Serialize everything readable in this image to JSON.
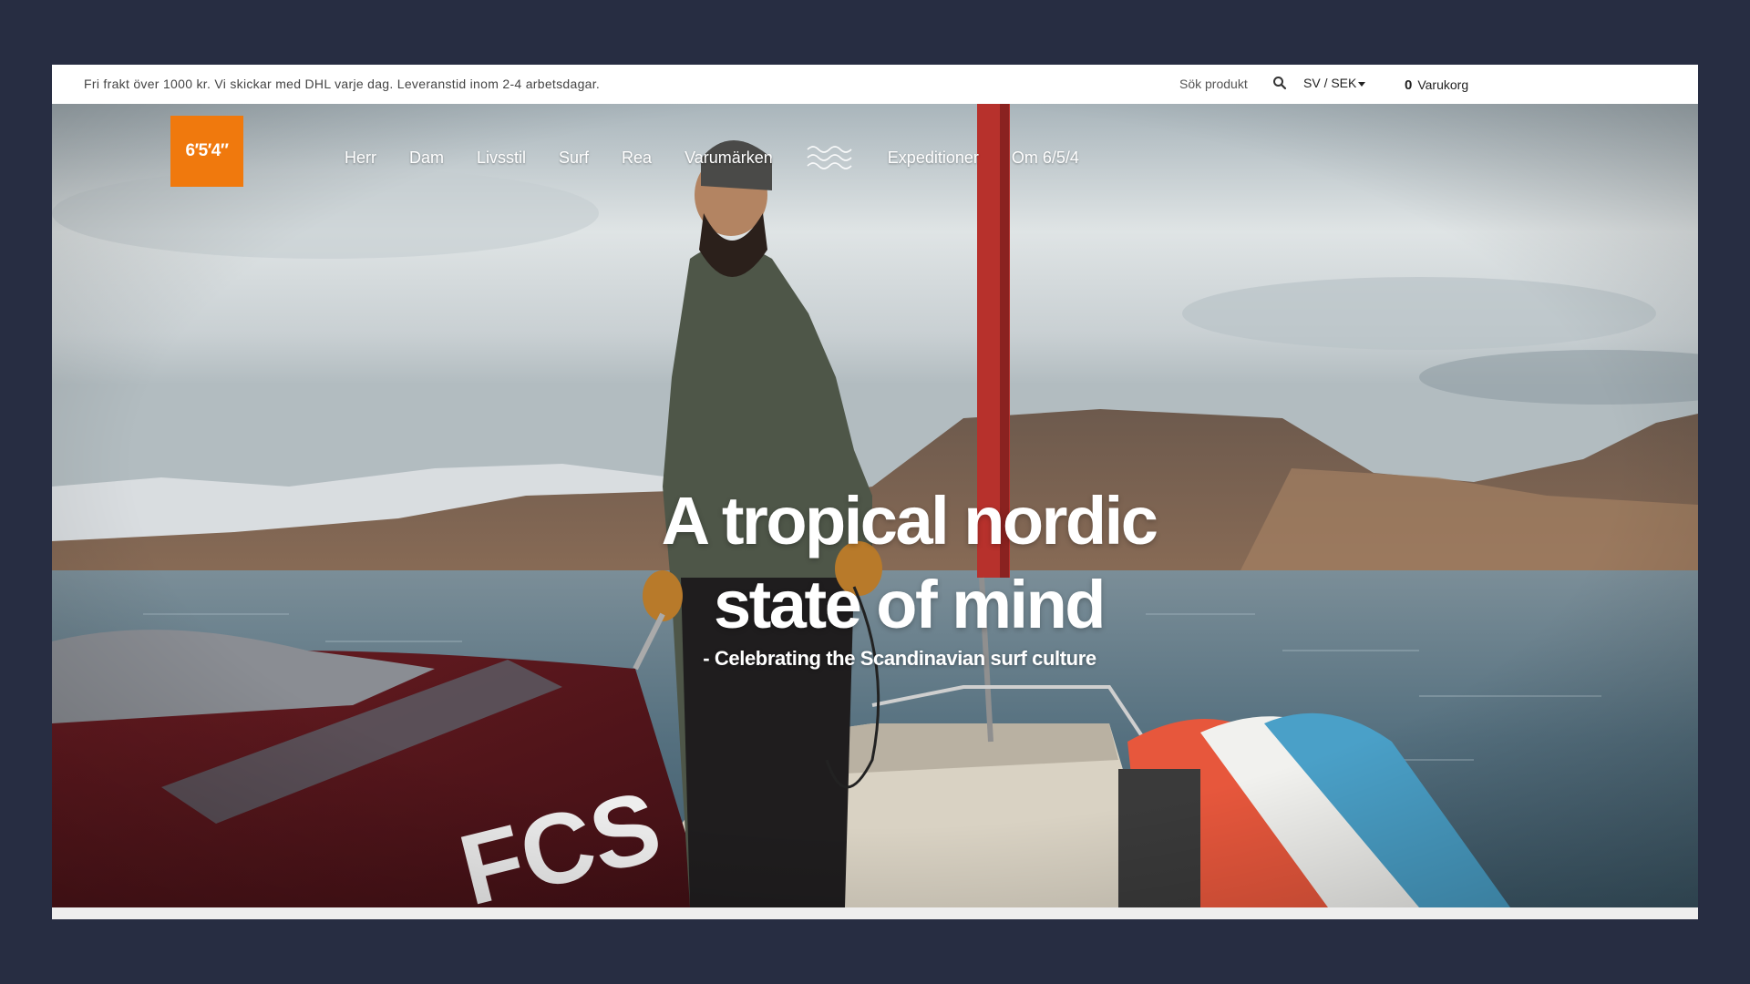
{
  "topbar": {
    "shipping_notice": "Fri frakt över 1000 kr. Vi skickar med DHL varje dag. Leveranstid inom 2-4 arbetsdagar.",
    "search_label": "Sök produkt",
    "search_icon": "search-icon",
    "language_currency": "SV / SEK",
    "cart_count": "0",
    "cart_label": "Varukorg"
  },
  "logo": {
    "text": "6′5′4″",
    "color": "#f0790d"
  },
  "nav": {
    "items": [
      {
        "label": "Herr"
      },
      {
        "label": "Dam"
      },
      {
        "label": "Livsstil"
      },
      {
        "label": "Surf"
      },
      {
        "label": "Rea"
      },
      {
        "label": "Varumärken"
      }
    ],
    "waves_icon": "waves-icon",
    "items_after": [
      {
        "label": "Expeditioner"
      },
      {
        "label": "Om 6/5/4"
      }
    ]
  },
  "hero": {
    "headline_line1": "A tropical nordic",
    "headline_line2": "state of mind",
    "tagline": "-  Celebrating the Scandinavian surf culture",
    "board_bag_brand": "FCS"
  },
  "colors": {
    "page_background": "#272d42",
    "accent": "#f0790d"
  }
}
